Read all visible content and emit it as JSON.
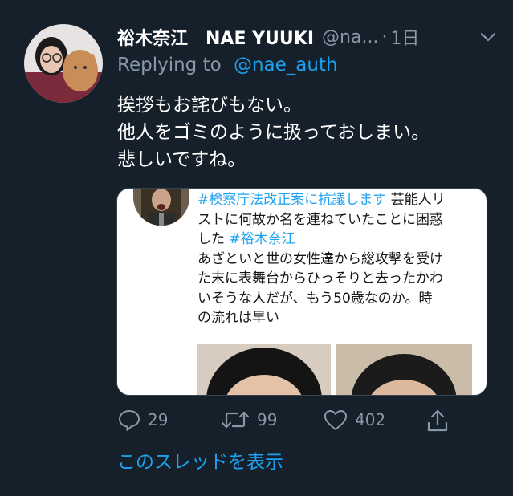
{
  "tweet": {
    "author_name": "裕木奈江　NAE YUUKI",
    "handle": "@na...",
    "separator": "·",
    "time": "1日",
    "reply_prefix": "Replying to",
    "reply_to": "@nae_auth",
    "text_lines": [
      "挨拶もお詫びもない。",
      "他人をゴミのように扱っておしまい。",
      "悲しいですね。"
    ]
  },
  "embedded": {
    "line1_tag": "#検察庁法改正案に抗議します",
    "line1_rest": " 芸能人リ",
    "line2": "ストに何故か名を連ねていたことに困惑",
    "line3_prefix": "した ",
    "line3_tag": "#裕木奈江",
    "line4": "あざといと世の女性達から総攻撃を受け",
    "line5": "た末に表舞台からひっそりと去ったかわ",
    "line6": "いそうな人だが、もう50歳なのか。時",
    "line7": "の流れは早い"
  },
  "actions": {
    "replies": "29",
    "retweets": "99",
    "likes": "402"
  },
  "thread_link": "このスレッドを表示",
  "colors": {
    "background": "#15202b",
    "secondary_text": "#8899a6",
    "accent": "#1da1f2"
  }
}
